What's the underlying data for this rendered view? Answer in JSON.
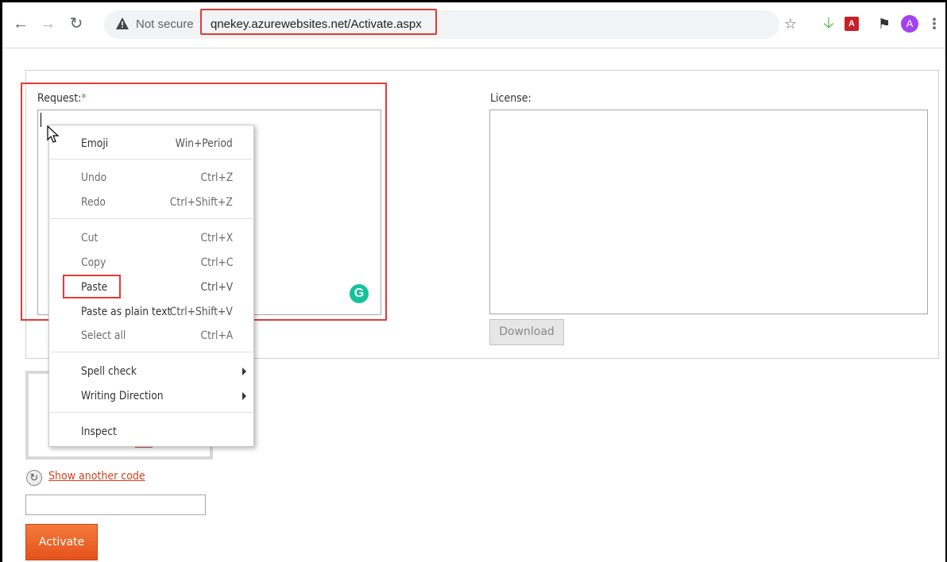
{
  "browser": {
    "security_label": "Not secure",
    "url": "qnekey.azurewebsites.net/Activate.aspx",
    "avatar_letter": "A"
  },
  "form": {
    "request_label": "Request:",
    "request_required_mark": "*",
    "license_label": "License:",
    "download_label": "Download",
    "show_another_code": "Show another code",
    "activate_label": "Activate"
  },
  "context_menu": {
    "items": [
      {
        "label": "Emoji",
        "shortcut": "Win+Period"
      },
      {
        "label": "Undo",
        "shortcut": "Ctrl+Z"
      },
      {
        "label": "Redo",
        "shortcut": "Ctrl+Shift+Z"
      },
      {
        "label": "Cut",
        "shortcut": "Ctrl+X"
      },
      {
        "label": "Copy",
        "shortcut": "Ctrl+C"
      },
      {
        "label": "Paste",
        "shortcut": "Ctrl+V"
      },
      {
        "label": "Paste as plain text",
        "shortcut": "Ctrl+Shift+V"
      },
      {
        "label": "Select all",
        "shortcut": "Ctrl+A"
      },
      {
        "label": "Spell check"
      },
      {
        "label": "Writing Direction"
      },
      {
        "label": "Inspect"
      }
    ]
  },
  "colors": {
    "highlight": "#e53935",
    "activate": "#ee6428",
    "link": "#d0421b"
  }
}
